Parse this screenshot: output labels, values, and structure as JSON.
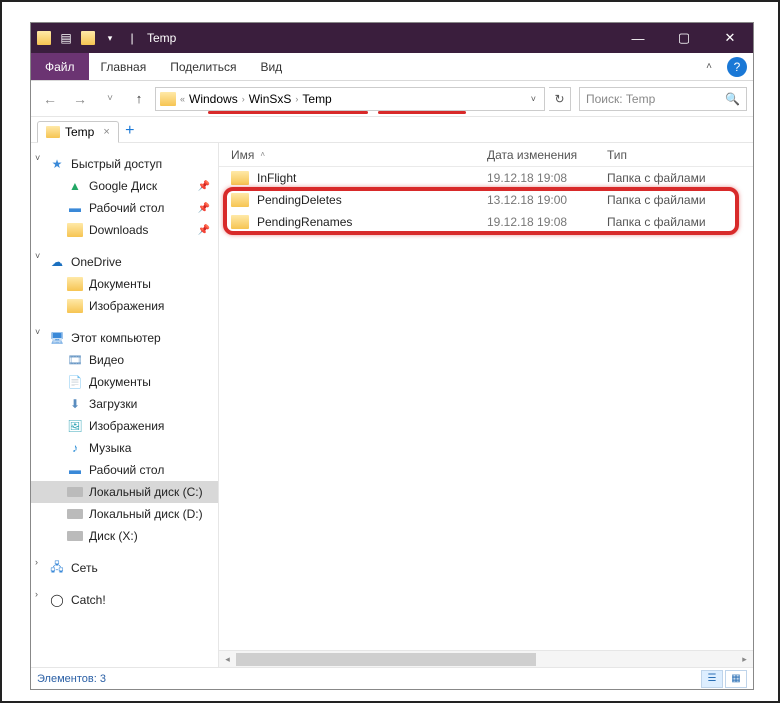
{
  "window": {
    "title": "Temp",
    "controls": {
      "minimize": "—",
      "maximize": "▢",
      "close": "✕"
    }
  },
  "ribbon": {
    "file": "Файл",
    "tabs": [
      "Главная",
      "Поделиться",
      "Вид"
    ]
  },
  "nav": {
    "back": "←",
    "forward": "→",
    "recent": "˅",
    "up": "↑",
    "overflow": "«",
    "breadcrumbs": [
      "Windows",
      "WinSxS",
      "Temp"
    ],
    "refresh": "↻",
    "search_placeholder": "Поиск: Temp"
  },
  "tabstrip": {
    "active": "Temp",
    "close": "×",
    "add": "+"
  },
  "tree": {
    "quick": {
      "label": "Быстрый доступ",
      "items": [
        {
          "label": "Google Диск",
          "icon": "gdrive",
          "pinned": true
        },
        {
          "label": "Рабочий стол",
          "icon": "desktop",
          "pinned": true
        },
        {
          "label": "Downloads",
          "icon": "folder",
          "pinned": true
        }
      ]
    },
    "onedrive": {
      "label": "OneDrive",
      "items": [
        {
          "label": "Документы",
          "icon": "folder"
        },
        {
          "label": "Изображения",
          "icon": "folder"
        }
      ]
    },
    "pc": {
      "label": "Этот компьютер",
      "items": [
        {
          "label": "Видео",
          "icon": "video"
        },
        {
          "label": "Документы",
          "icon": "doc"
        },
        {
          "label": "Загрузки",
          "icon": "down"
        },
        {
          "label": "Изображения",
          "icon": "img"
        },
        {
          "label": "Музыка",
          "icon": "music"
        },
        {
          "label": "Рабочий стол",
          "icon": "desktop"
        },
        {
          "label": "Локальный диск (C:)",
          "icon": "disk",
          "selected": true
        },
        {
          "label": "Локальный диск (D:)",
          "icon": "disk"
        },
        {
          "label": "Диск (X:)",
          "icon": "disk"
        }
      ]
    },
    "network": {
      "label": "Сеть"
    },
    "catch": {
      "label": "Catch!"
    }
  },
  "columns": {
    "name": "Имя",
    "date": "Дата изменения",
    "type": "Тип"
  },
  "rows": [
    {
      "name": "InFlight",
      "date": "19.12.18 19:08",
      "type": "Папка с файлами"
    },
    {
      "name": "PendingDeletes",
      "date": "13.12.18 19:00",
      "type": "Папка с файлами"
    },
    {
      "name": "PendingRenames",
      "date": "19.12.18 19:08",
      "type": "Папка с файлами"
    }
  ],
  "status": {
    "items": "Элементов: 3"
  }
}
